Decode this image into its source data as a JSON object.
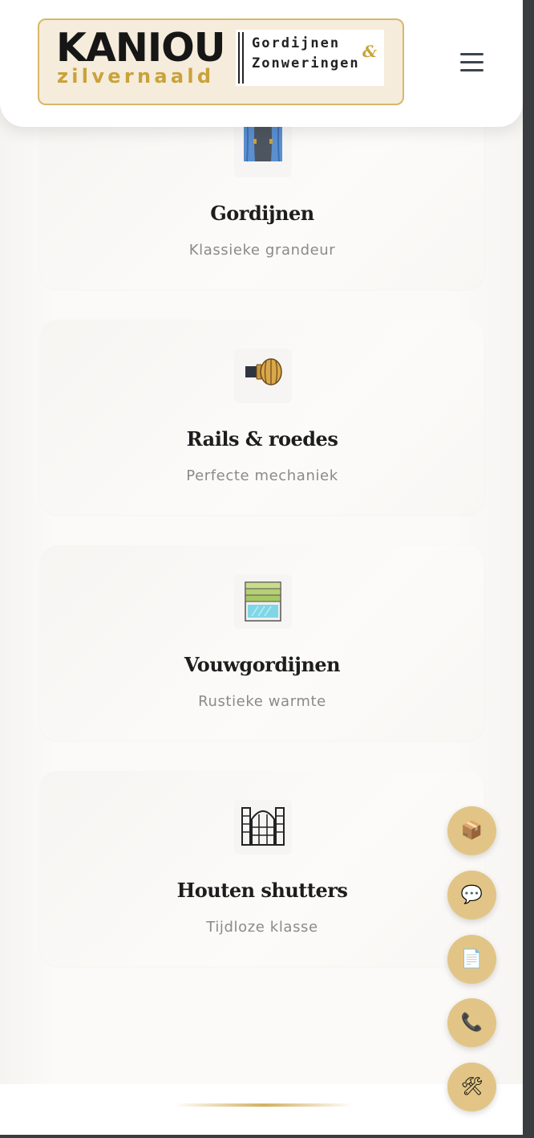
{
  "header": {
    "logo": {
      "brand": "KANIOU",
      "sub_brand": "zilvernaald",
      "line1": "Gordijnen",
      "ampersand": "&",
      "line2": "Zonweringen"
    },
    "menu_icon": "hamburger-menu-icon"
  },
  "cards": [
    {
      "title": "Gordijnen",
      "subtitle": "Klassieke grandeur",
      "icon": "curtain-icon"
    },
    {
      "title": "Rails & roedes",
      "subtitle": "Perfecte mechaniek",
      "icon": "curtain-rod-icon"
    },
    {
      "title": "Vouwgordijnen",
      "subtitle": "Rustieke warmte",
      "icon": "roman-blind-icon"
    },
    {
      "title": "Houten shutters",
      "subtitle": "Tijdloze klasse",
      "icon": "shutter-icon"
    }
  ],
  "floating_buttons": [
    {
      "name": "package-icon",
      "glyph": "📦"
    },
    {
      "name": "chat-icon",
      "glyph": "💬"
    },
    {
      "name": "document-icon",
      "glyph": "📄"
    },
    {
      "name": "phone-icon",
      "glyph": "📞"
    },
    {
      "name": "tools-icon",
      "glyph": "🛠"
    }
  ],
  "colors": {
    "accent_gold": "#d4af5f",
    "fab_background": "#e2c586",
    "logo_background": "#f5ecdc",
    "title_text": "#1d1d1d",
    "subtitle_text": "#8a8a8a"
  }
}
